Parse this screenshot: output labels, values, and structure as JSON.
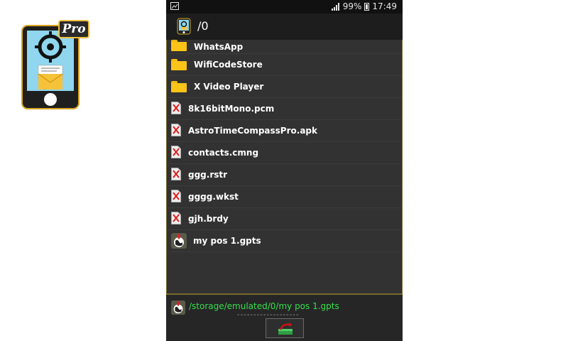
{
  "app": {
    "pro_label": "Pro"
  },
  "status_bar": {
    "battery": "99%",
    "time": "17:49"
  },
  "toolbar": {
    "path": "/0"
  },
  "files": [
    {
      "name": "WhatsApp",
      "type": "folder"
    },
    {
      "name": "WifiCodeStore",
      "type": "folder"
    },
    {
      "name": "X Video Player",
      "type": "folder"
    },
    {
      "name": "8k16bitMono.pcm",
      "type": "unknown"
    },
    {
      "name": "AstroTimeCompassPro.apk",
      "type": "unknown"
    },
    {
      "name": "contacts.cmng",
      "type": "unknown"
    },
    {
      "name": "ggg.rstr",
      "type": "unknown"
    },
    {
      "name": "gggg.wkst",
      "type": "unknown"
    },
    {
      "name": "gjh.brdy",
      "type": "unknown"
    },
    {
      "name": "my pos 1.gpts",
      "type": "gpts"
    }
  ],
  "selection": {
    "path": "/storage/emulated/0/my pos 1.gpts",
    "separator": "-------------------"
  },
  "colors": {
    "accent": "#33e04a",
    "folder": "#fcc419",
    "border": "#7a6a2a"
  }
}
